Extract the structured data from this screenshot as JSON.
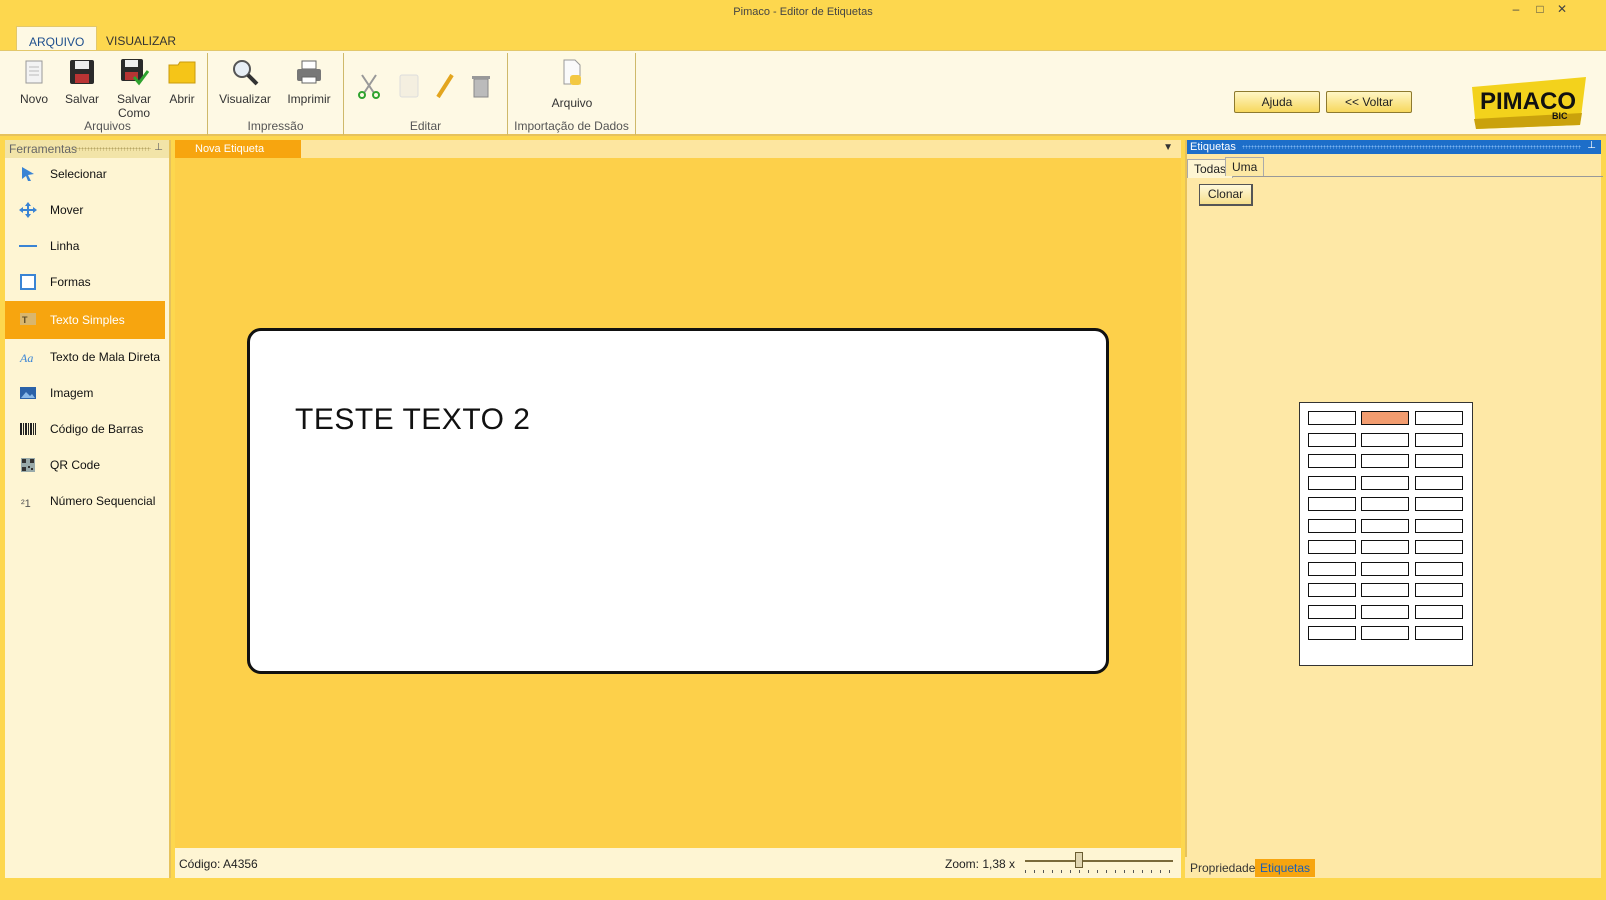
{
  "window": {
    "title": "Pimaco - Editor de Etiquetas",
    "minimize": "–",
    "maximize": "□",
    "close": "✕"
  },
  "ribbon_tabs": [
    {
      "label": "ARQUIVO",
      "active": true
    },
    {
      "label": "VISUALIZAR",
      "active": false
    }
  ],
  "ribbon": {
    "groups": {
      "arquivos": "Arquivos",
      "impressao": "Impressão",
      "editar": "Editar",
      "importacao": "Importação de Dados"
    },
    "buttons": {
      "novo": "Novo",
      "salvar": "Salvar",
      "salvar_como": "Salvar Como",
      "abrir": "Abrir",
      "visualizar": "Visualizar",
      "imprimir": "Imprimir",
      "arquivo": "Arquivo"
    },
    "ajuda": "Ajuda",
    "voltar": "<< Voltar",
    "logo_text": "PIMACO",
    "logo_sub": "BIC"
  },
  "tools_panel": {
    "title": "Ferramentas",
    "pin": "⊥",
    "items": [
      {
        "label": "Selecionar",
        "icon": "arrow-cursor-icon"
      },
      {
        "label": "Mover",
        "icon": "move-arrows-icon"
      },
      {
        "label": "Linha",
        "icon": "line-icon"
      },
      {
        "label": "Formas",
        "icon": "shape-square-icon"
      },
      {
        "label": "Texto Simples",
        "icon": "text-icon",
        "active": true
      },
      {
        "label": "Texto de Mala Direta",
        "icon": "mail-text-icon"
      },
      {
        "label": "Imagem",
        "icon": "image-icon"
      },
      {
        "label": "Código de Barras",
        "icon": "barcode-icon"
      },
      {
        "label": "QR Code",
        "icon": "qr-code-icon"
      },
      {
        "label": "Número Sequencial",
        "icon": "sequential-number-icon"
      }
    ]
  },
  "document": {
    "tab": "Nova Etiqueta",
    "dropdown": "▼",
    "label_text": "TESTE TEXTO 2"
  },
  "statusbar": {
    "code": "Código: A4356",
    "zoom": "Zoom: 1,38 x",
    "zoom_slider_fraction": 0.36
  },
  "labels_panel": {
    "title": "Etiquetas",
    "pin": "⊥",
    "subtabs": [
      {
        "label": "Todas",
        "active": false
      },
      {
        "label": "Uma",
        "active": true
      }
    ],
    "clone_button": "Clonar",
    "sheet": {
      "rows": 11,
      "cols": 3,
      "selected": [
        0,
        1
      ]
    }
  },
  "bottom_tabs": [
    {
      "label": "Propriedades",
      "active": false
    },
    {
      "label": "Etiquetas",
      "active": true
    }
  ],
  "colors": {
    "background": "#fdd74e",
    "accent_orange": "#f7a50f",
    "panel_blue": "#1d6ec9",
    "selected_cell": "#f29c6f"
  }
}
